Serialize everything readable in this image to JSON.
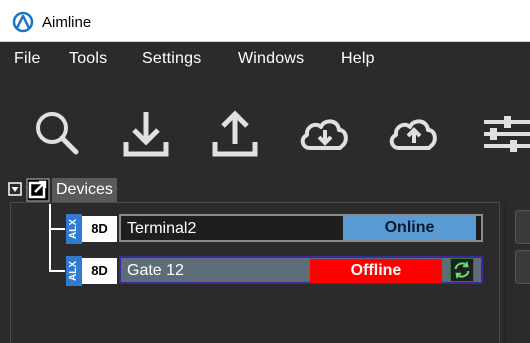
{
  "app": {
    "title": "Aimline"
  },
  "menu": {
    "items": [
      "File",
      "Tools",
      "Settings",
      "Windows",
      "Help"
    ]
  },
  "toolbar": {
    "tools": [
      {
        "name": "search-icon"
      },
      {
        "name": "download-icon"
      },
      {
        "name": "upload-icon"
      },
      {
        "name": "cloud-download-icon"
      },
      {
        "name": "cloud-upload-icon"
      },
      {
        "name": "sliders-icon"
      }
    ]
  },
  "tree": {
    "root_label": "Devices",
    "devices": [
      {
        "brand": "ALX",
        "type": "8D",
        "name": "Terminal2",
        "status": "Online",
        "status_color": "#5b9bd5"
      },
      {
        "brand": "ALX",
        "type": "8D",
        "name": "Gate 12",
        "status": "Offline",
        "status_color": "#ff0000"
      }
    ]
  },
  "colors": {
    "background": "#2b2b2b",
    "accent": "#2f7bd2",
    "online": "#5b9bd5",
    "offline": "#ff0000"
  }
}
